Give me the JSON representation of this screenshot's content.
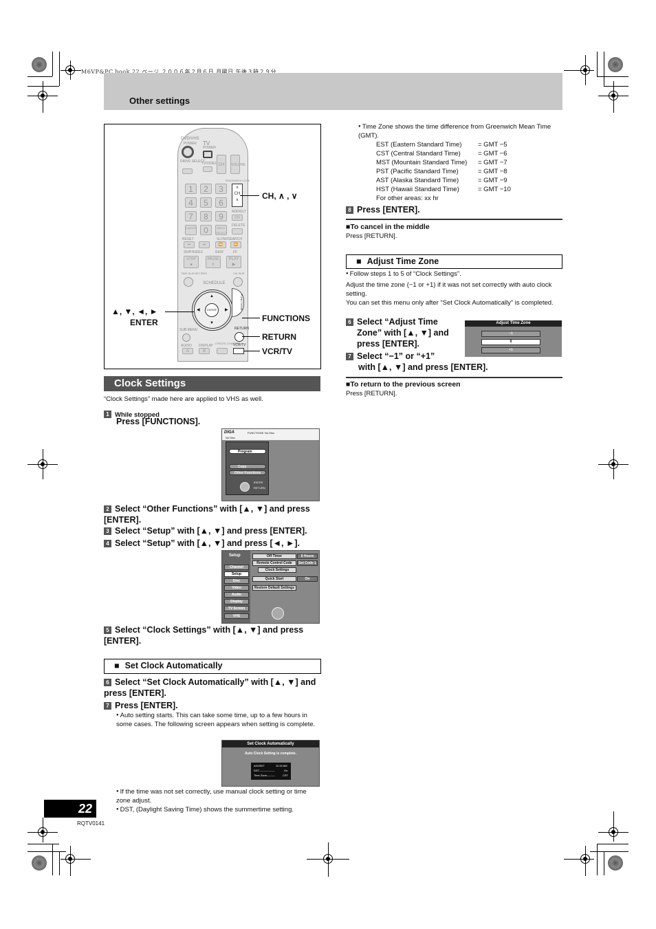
{
  "print_header": "M6VP&PC.book  22 ページ  ２００６年２月６日  月曜日  午後３時２９分",
  "header": {
    "title": "Other settings"
  },
  "remote": {
    "labels": {
      "dvdvhs": "DVD/VHS",
      "power": "POWER",
      "tv": "TV",
      "tv_power": "POWER",
      "drive_select": "DRIVE SELECT",
      "tv_video": "TV/VIDEO",
      "ch": "CH",
      "volume": "VOLUME",
      "tracking": "TRACKING/V-LOCK",
      "add_dlt": "ADD/DLT",
      "delete": "DELETE",
      "cancel": "CANCEL",
      "reset": "RESET",
      "input_select": "INPUT SELECT",
      "slow_search": "SLOW/SEARCH",
      "skip_index": "SKIP/INDEX",
      "rew": "REW",
      "ff": "FF",
      "stop": "STOP",
      "pause": "PAUSE",
      "play": "PLAY",
      "time_slip": "TIME SLIP/JET REW",
      "cm_skip": "CM SKIP",
      "schedule": "SCHEDULE",
      "enter": "ENTER",
      "functions": "FUNCTIONS",
      "sub_menu": "SUB MENU",
      "return": "RETURN",
      "audio": "AUDIO",
      "display": "DISPLAY",
      "create_chapter": "CREATE CHAPTER",
      "vcr_tv": "VCR/TV",
      "status": "STATUS",
      "a": "A",
      "b": "B"
    },
    "numbers": [
      "1",
      "2",
      "3",
      "4",
      "5",
      "6",
      "7",
      "8",
      "9",
      "0"
    ],
    "callouts": {
      "ch": "CH, ∧ , ∨",
      "arrows": "▲, ▼, ◄, ►",
      "enter": "ENTER",
      "functions": "FUNCTIONS",
      "return": "RETURN",
      "vcr_tv": "VCR/TV"
    }
  },
  "clock_settings": {
    "title": "Clock Settings",
    "intro": "“Clock Settings” made here are applied to VHS as well.",
    "step1": {
      "num": "1",
      "sub": "While stopped",
      "text": "Press [FUNCTIONS]."
    },
    "step2": {
      "num": "2",
      "text": "Select “Other Functions” with [▲, ▼] and press [ENTER]."
    },
    "step3": {
      "num": "3",
      "text": "Select “Setup” with [▲, ▼] and press [ENTER]."
    },
    "step4": {
      "num": "4",
      "text": "Select “Setup” with [▲, ▼] and press [◄, ►]."
    },
    "step5": {
      "num": "5",
      "text": "Select “Clock Settings” with [▲, ▼] and press [ENTER]."
    }
  },
  "functions_screen": {
    "brand": "DIGA",
    "title": "FUNCTIONS",
    "disc": "No Disc",
    "sub": "No Disc",
    "items": [
      "Program",
      "Copy",
      "Other Functions"
    ],
    "enter": "ENTER",
    "return": "RETURN"
  },
  "setup_screen": {
    "title": "Setup",
    "tabs": [
      "Channel",
      "Setup",
      "Disc",
      "Video",
      "Audio",
      "Display",
      "TV Screen",
      "VHS"
    ],
    "selected_tab": "Setup",
    "rows": [
      {
        "label": "Off Timer",
        "value": "6 Hours"
      },
      {
        "label": "Remote Control Code",
        "value": "Set Code 1"
      },
      {
        "label": "Clock Settings",
        "value": ""
      },
      {
        "label": "Quick Start",
        "value": "On"
      },
      {
        "label": "Restore Default Settings",
        "value": ""
      }
    ]
  },
  "set_clock_auto": {
    "heading": "Set Clock Automatically",
    "step6": {
      "num": "6",
      "text": "Select “Set Clock Automatically” with [▲, ▼] and press [ENTER]."
    },
    "step7": {
      "num": "7",
      "text": "Press [ENTER]."
    },
    "note": "Auto setting starts. This can take some time, up to a few hours in some cases. The following screen appears when setting is complete.",
    "screen": {
      "title": "Set Clock Automatically",
      "message": "Auto Clock Setting is complete.",
      "date": "4/4/2007",
      "time": "11:15 AM",
      "dst_label": "DST-----------------",
      "dst_value": "On",
      "tz_label": "Time Zone---------",
      "tz_value": "CST"
    },
    "bullets": [
      "If the time was not set correctly, use manual clock setting or time zone adjust.",
      "DST, (Daylight Saving Time) shows the summertime setting."
    ]
  },
  "timezone_info": {
    "intro": "Time Zone shows the time difference from Greenwich Mean Time (GMT).",
    "zones": [
      {
        "name": "EST  (Eastern Standard Time)",
        "offset": "= GMT −5"
      },
      {
        "name": "CST  (Central Standard Time)",
        "offset": "= GMT −6"
      },
      {
        "name": "MST  (Mountain Standard Time)",
        "offset": "= GMT −7"
      },
      {
        "name": "PST  (Pacific Standard Time)",
        "offset": "= GMT −8"
      },
      {
        "name": "AST  (Alaska Standard Time)",
        "offset": "= GMT −9"
      },
      {
        "name": "HST  (Hawaii Standard Time)",
        "offset": "= GMT −10"
      }
    ],
    "other": "For other areas: xx hr",
    "step8": {
      "num": "8",
      "text": "Press [ENTER]."
    },
    "cancel_head": "To cancel in the middle",
    "cancel_text": "Press [RETURN]."
  },
  "adjust_time_zone": {
    "heading": "Adjust Time Zone",
    "bullet": "Follow steps 1 to 5 of “Clock Settings”.",
    "para1": "Adjust the time zone (−1 or +1) if it was not set correctly with auto clock setting.",
    "para2": "You can set this menu only after “Set Clock Automatically” is completed.",
    "step6": {
      "num": "6",
      "text": "Select “Adjust Time Zone” with [▲, ▼] and press [ENTER]."
    },
    "step7": {
      "num": "7",
      "text_a": "Select “−1” or “+1”",
      "text_b": "with [▲, ▼] and press [ENTER]."
    },
    "screen": {
      "title": "Adjust Time Zone",
      "options": [
        "−1",
        "0",
        "+1"
      ],
      "selected": "0"
    },
    "return_head": "To return to the previous screen",
    "return_text": "Press [RETURN]."
  },
  "footer": {
    "page_number": "22",
    "code": "RQTV0141"
  }
}
